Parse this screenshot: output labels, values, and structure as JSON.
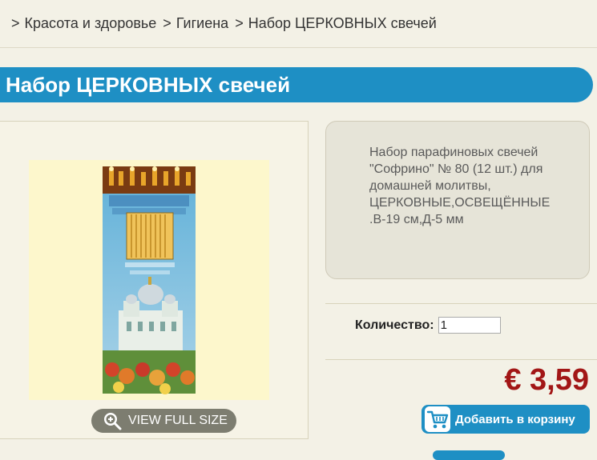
{
  "breadcrumb": {
    "items": [
      {
        "separator": ">",
        "label": "Красота и здоровье"
      },
      {
        "separator": ">",
        "label": "Гигиена"
      },
      {
        "separator": ">",
        "label": "Набор ЦЕРКОВНЫХ свечей"
      }
    ]
  },
  "product": {
    "title": "Набор ЦЕРКОВНЫХ свечей",
    "description_lines": [
      "Набор парафиновых свечей",
      "\"Софрино\" № 80 (12 шт.) для",
      "домашней молитвы,",
      "ЦЕРКОВНЫЕ,ОСВЕЩЁННЫЕ",
      ".В-19 см,Д-5 мм"
    ],
    "view_full_size": "VIEW FULL SIZE",
    "quantity_label": "Количество:",
    "quantity_value": "1",
    "price": "€ 3,59",
    "add_to_cart": "Добавить в корзину"
  },
  "colors": {
    "accent": "#1e8fc4",
    "price": "#a21616",
    "background": "#f3f1e6"
  },
  "icons": {
    "zoom": "zoom-in-icon",
    "cart": "shopping-cart-icon"
  }
}
